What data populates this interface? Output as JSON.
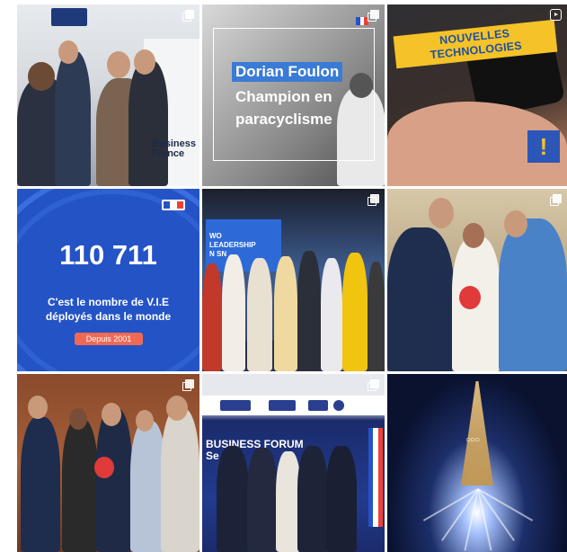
{
  "posts": [
    {
      "id": 1,
      "type": "carousel",
      "overlay_text": [
        "Business",
        "France"
      ]
    },
    {
      "id": 2,
      "type": "carousel",
      "overlay_lines": [
        "Dorian Foulon",
        "Champion en",
        "paracyclisme"
      ]
    },
    {
      "id": 3,
      "type": "reel",
      "banner": "NOUVELLES TECHNOLOGIES",
      "badge": "!"
    },
    {
      "id": 4,
      "type": "carousel",
      "number": "110 711",
      "caption_line1": "C'est le nombre de V.I.E",
      "caption_line2": "déployés dans le monde",
      "pill": "Depuis 2001"
    },
    {
      "id": 5,
      "type": "carousel",
      "screen_text": [
        "WO",
        "LEADERSHIP",
        "N SN"
      ]
    },
    {
      "id": 6,
      "type": "carousel"
    },
    {
      "id": 7,
      "type": "carousel"
    },
    {
      "id": 8,
      "type": "carousel",
      "title_line1": "BUSINESS FORUM",
      "title_line2": "Se"
    },
    {
      "id": 9,
      "type": "image"
    }
  ],
  "colors": {
    "france_blue": "#2453c6",
    "france_red": "#ef4135",
    "accent_yellow": "#f5c228",
    "highlight_blue": "#3a7bd5",
    "pill_coral": "#ef6a54"
  }
}
